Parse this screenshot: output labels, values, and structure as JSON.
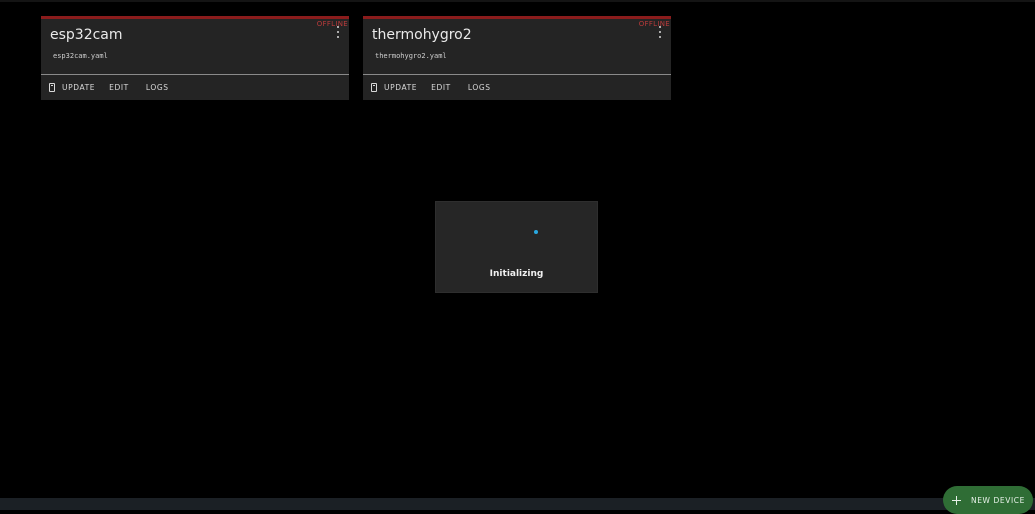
{
  "devices": [
    {
      "name": "esp32cam",
      "file": "esp32cam.yaml",
      "status": "OFFLINE",
      "actions": {
        "update": "UPDATE",
        "edit": "EDIT",
        "logs": "LOGS"
      }
    },
    {
      "name": "thermohygro2",
      "file": "thermohygro2.yaml",
      "status": "OFFLINE",
      "actions": {
        "update": "UPDATE",
        "edit": "EDIT",
        "logs": "LOGS"
      }
    }
  ],
  "dialog": {
    "message": "Initializing"
  },
  "fab": {
    "label": "NEW DEVICE",
    "icon": "plus-icon"
  },
  "footer": {
    "text": ""
  },
  "colors": {
    "offline": "#b83a3a",
    "card_top_border": "#8b1c1c",
    "spinner": "#29a8e0",
    "fab": "#2f6d35"
  }
}
